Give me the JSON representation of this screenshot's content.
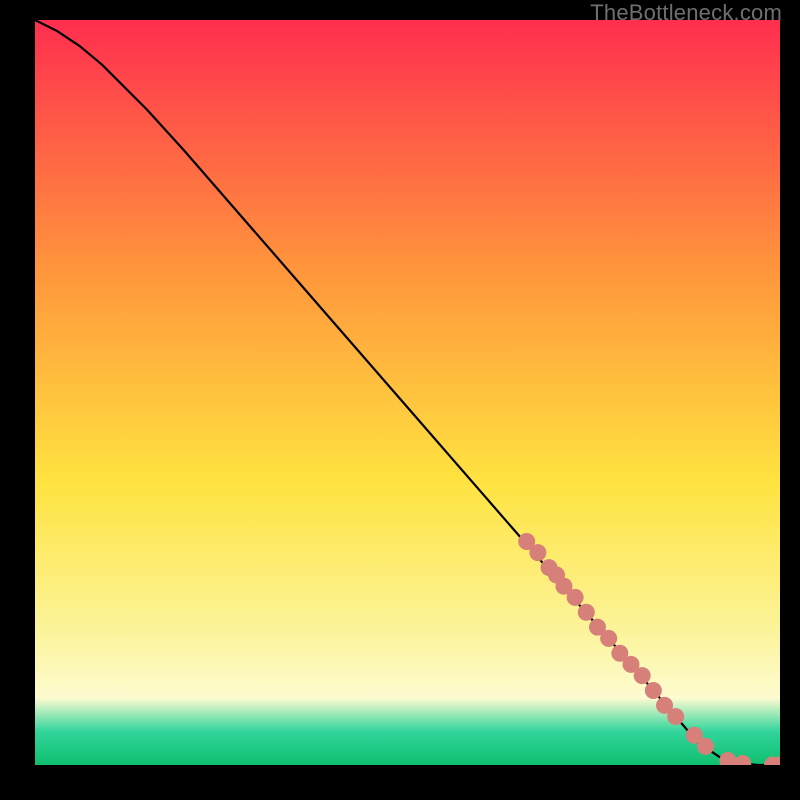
{
  "watermark": "TheBottleneck.com",
  "colors": {
    "grad_top": "#ff2e4f",
    "grad_orange": "#ff943c",
    "grad_yellow": "#ffe340",
    "grad_lightyellow": "#fcf49a",
    "grad_paleyellow": "#fdfbd0",
    "grad_teal": "#32d59c",
    "grad_green": "#0fbf6e",
    "line": "#000000",
    "marker_fill": "#d77f79",
    "marker_stroke": "#c96f69",
    "background": "#000000"
  },
  "chart_data": {
    "type": "line",
    "title": "",
    "xlabel": "",
    "ylabel": "",
    "xlim": [
      0,
      100
    ],
    "ylim": [
      0,
      100
    ],
    "series": [
      {
        "name": "curve",
        "x": [
          0,
          3,
          6,
          9,
          12,
          15,
          20,
          30,
          40,
          50,
          60,
          70,
          80,
          86,
          89,
          92,
          95,
          97,
          100
        ],
        "y": [
          100,
          98.5,
          96.5,
          94,
          91,
          88,
          82.5,
          71,
          59.5,
          48,
          36.5,
          25,
          13.5,
          6.5,
          3,
          1,
          0.2,
          0,
          0
        ]
      }
    ],
    "markers": {
      "name": "highlight-points",
      "x": [
        66,
        67.5,
        69,
        70,
        71,
        72.5,
        74,
        75.5,
        77,
        78.5,
        80,
        81.5,
        83,
        84.5,
        86,
        88.5,
        90,
        93,
        95,
        99,
        100
      ],
      "y": [
        30,
        28.5,
        26.5,
        25.5,
        24,
        22.5,
        20.5,
        18.5,
        17,
        15,
        13.5,
        12,
        10,
        8,
        6.5,
        4,
        2.5,
        0.6,
        0.2,
        0,
        0
      ]
    }
  }
}
